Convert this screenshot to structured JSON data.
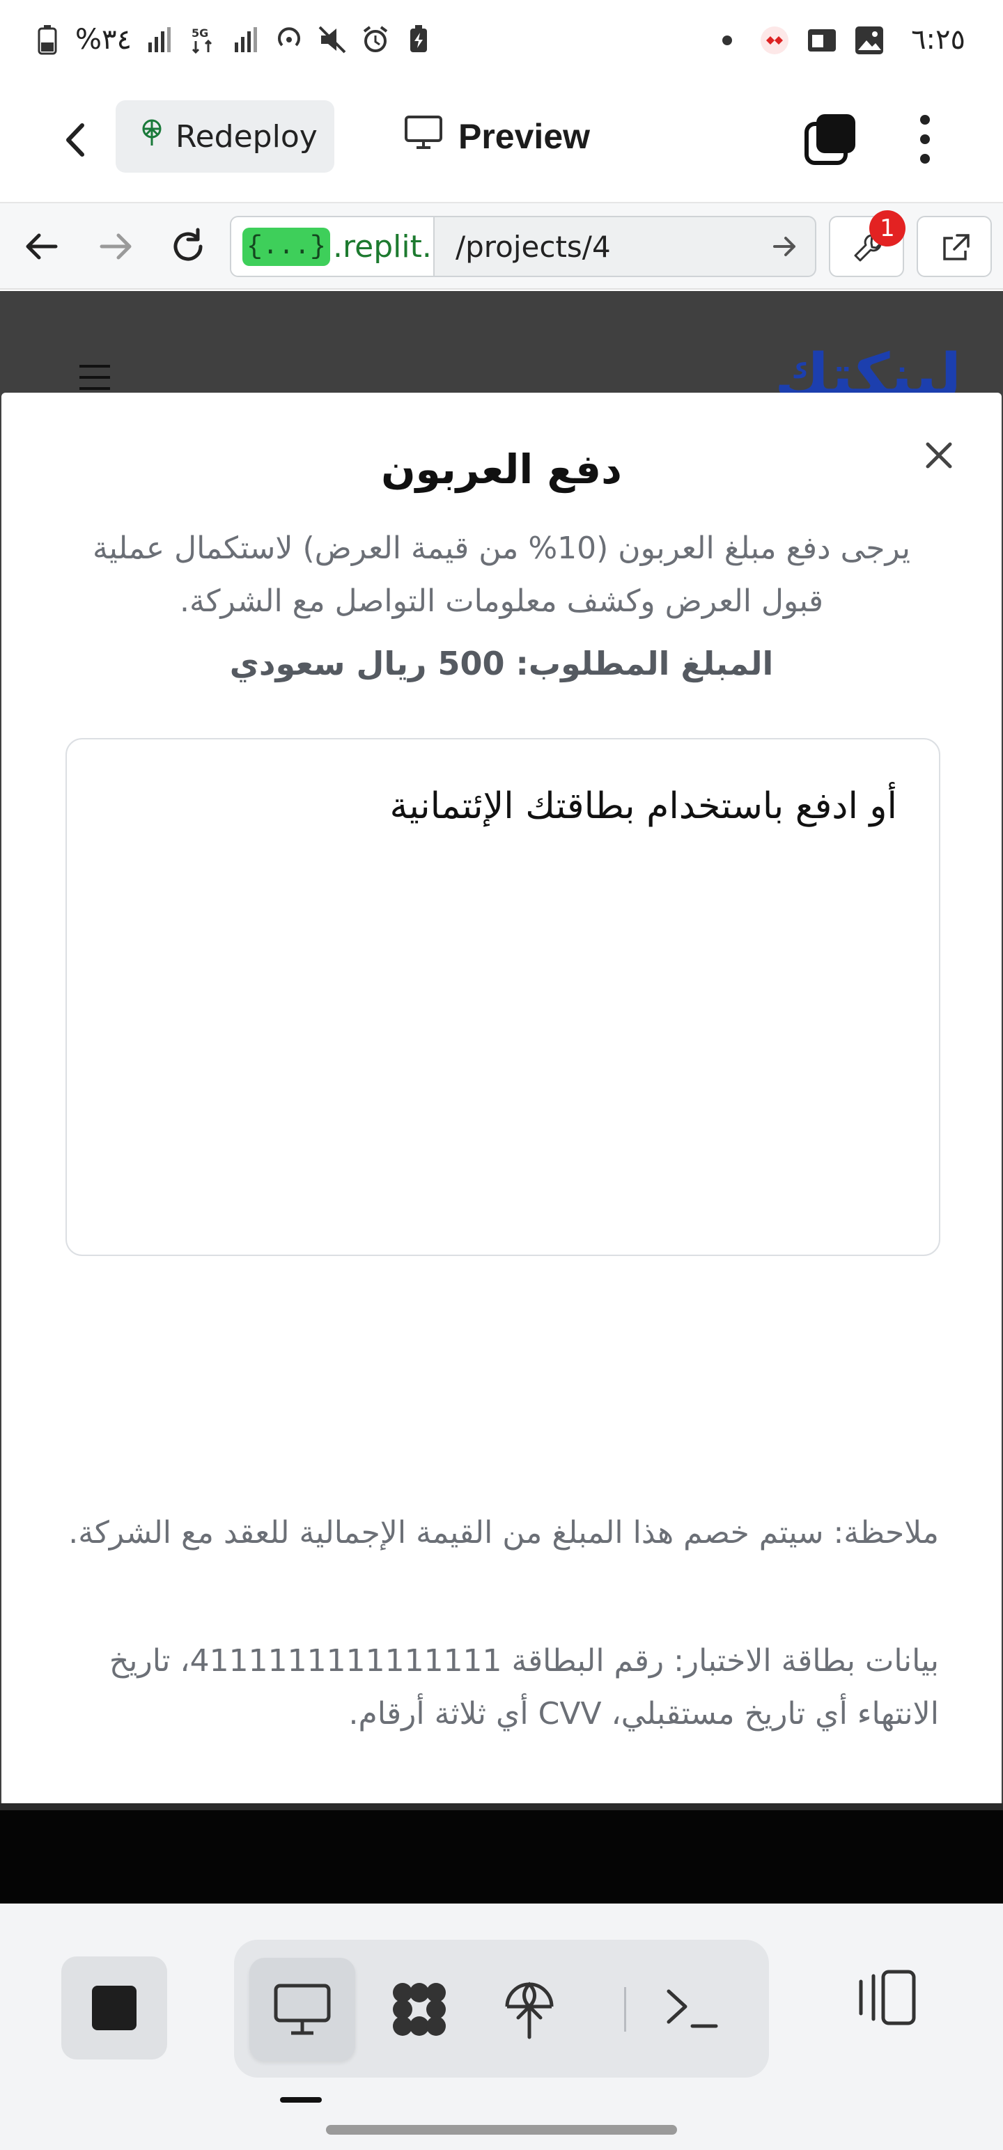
{
  "status_bar": {
    "time": "٦:٢٥",
    "battery": "%٣٤"
  },
  "app_header": {
    "redeploy_label": "Redeploy",
    "preview_label": "Preview"
  },
  "browser": {
    "url_badge": "{...}",
    "url_host": ".replit.de",
    "url_path": "/projects/4",
    "devtools_badge": "1"
  },
  "site": {
    "logo": "لينكتك"
  },
  "modal": {
    "title": "دفع العربون",
    "description": "يرجى دفع مبلغ العربون (10% من قيمة العرض) لاستكمال عملية قبول العرض وكشف معلومات التواصل مع الشركة.",
    "amount": "المبلغ المطلوب: 500 ريال سعودي",
    "card_title": "أو ادفع باستخدام بطاقتك الإئتمانية",
    "note1": "ملاحظة: سيتم خصم هذا المبلغ من القيمة الإجمالية للعقد مع الشركة.",
    "note2": "بيانات بطاقة الاختبار: رقم البطاقة 4111111111111111، تاريخ الانتهاء أي تاريخ مستقبلي، CVV أي ثلاثة أرقام."
  },
  "colors": {
    "accent_green": "#3ecf5a",
    "logo_blue": "#1c3fae",
    "badge_red": "#e32222"
  }
}
